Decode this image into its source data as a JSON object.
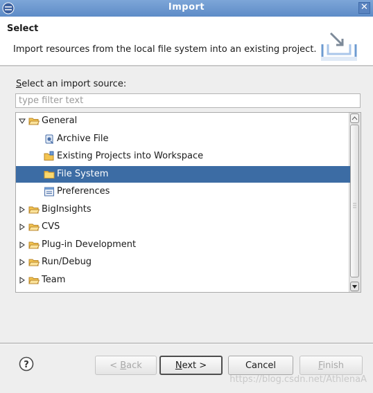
{
  "window": {
    "title": "Import"
  },
  "banner": {
    "heading": "Select",
    "description": "Import resources from the local file system into an existing project."
  },
  "source": {
    "label_mnemonic": "S",
    "label_rest": "elect an import source:",
    "filter_placeholder": "type filter text"
  },
  "tree": {
    "items": [
      {
        "label": "General",
        "expanded": true,
        "icon": "folder-open-icon",
        "level": 0
      },
      {
        "label": "Archive File",
        "icon": "archive-file-icon",
        "level": 1
      },
      {
        "label": "Existing Projects into Workspace",
        "icon": "project-icon",
        "level": 1
      },
      {
        "label": "File System",
        "icon": "folder-icon",
        "level": 1,
        "selected": true
      },
      {
        "label": "Preferences",
        "icon": "preferences-icon",
        "level": 1
      },
      {
        "label": "BigInsights",
        "expanded": false,
        "icon": "folder-open-icon",
        "level": 0
      },
      {
        "label": "CVS",
        "expanded": false,
        "icon": "folder-open-icon",
        "level": 0
      },
      {
        "label": "Plug-in Development",
        "expanded": false,
        "icon": "folder-open-icon",
        "level": 0
      },
      {
        "label": "Run/Debug",
        "expanded": false,
        "icon": "folder-open-icon",
        "level": 0
      },
      {
        "label": "Team",
        "expanded": false,
        "icon": "folder-open-icon",
        "level": 0
      }
    ]
  },
  "buttons": {
    "back_pre": "< ",
    "back_mn": "B",
    "back_post": "ack",
    "next_mn": "N",
    "next_post": "ext >",
    "cancel": "Cancel",
    "finish_mn": "F",
    "finish_post": "inish"
  },
  "watermark": "https://blog.csdn.net/AthlenaA",
  "colors": {
    "titlebar": "#6f9bd2",
    "selection": "#3c6ca4",
    "folder": "#f3c451",
    "panel": "#eeeeee"
  }
}
